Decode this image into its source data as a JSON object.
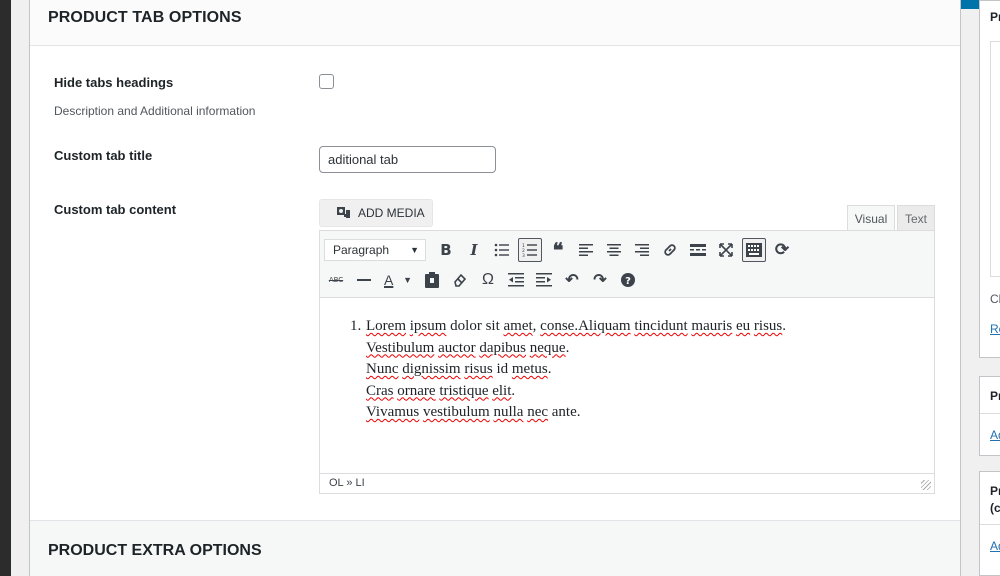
{
  "panel": {
    "title": "PRODUCT TAB OPTIONS",
    "hide_tabs": {
      "label": "Hide tabs headings",
      "description": "Description and Additional information",
      "checked": false
    },
    "custom_title": {
      "label": "Custom tab title",
      "value": "aditional tab"
    },
    "custom_content": {
      "label": "Custom tab content"
    }
  },
  "editor": {
    "add_media_label": "ADD MEDIA",
    "tabs": {
      "visual": "Visual",
      "text": "Text"
    },
    "format_select": "Paragraph",
    "list_number": "1.",
    "lines": [
      [
        {
          "t": "Lorem",
          "s": true
        },
        {
          "t": " "
        },
        {
          "t": "ipsum",
          "s": true
        },
        {
          "t": " dolor sit "
        },
        {
          "t": "amet",
          "s": true
        },
        {
          "t": ", "
        },
        {
          "t": "conse.Aliquam",
          "s": true
        },
        {
          "t": " "
        },
        {
          "t": "tincidunt",
          "s": true
        },
        {
          "t": " "
        },
        {
          "t": "mauris",
          "s": true
        },
        {
          "t": " "
        },
        {
          "t": "eu",
          "s": true
        },
        {
          "t": " "
        },
        {
          "t": "risus",
          "s": true
        },
        {
          "t": "."
        }
      ],
      [
        {
          "t": "Vestibulum",
          "s": true
        },
        {
          "t": " "
        },
        {
          "t": "auctor",
          "s": true
        },
        {
          "t": " "
        },
        {
          "t": "dapibus",
          "s": true
        },
        {
          "t": " "
        },
        {
          "t": "neque",
          "s": true
        },
        {
          "t": "."
        }
      ],
      [
        {
          "t": "Nunc",
          "s": true
        },
        {
          "t": " "
        },
        {
          "t": "dignissim",
          "s": true
        },
        {
          "t": " "
        },
        {
          "t": "risus",
          "s": true
        },
        {
          "t": " id "
        },
        {
          "t": "metus",
          "s": true
        },
        {
          "t": "."
        }
      ],
      [
        {
          "t": "Cras",
          "s": true
        },
        {
          "t": " "
        },
        {
          "t": "ornare",
          "s": true
        },
        {
          "t": " "
        },
        {
          "t": "tristique",
          "s": true
        },
        {
          "t": " "
        },
        {
          "t": "elit",
          "s": true
        },
        {
          "t": "."
        }
      ],
      [
        {
          "t": "Vivamus",
          "s": true
        },
        {
          "t": " "
        },
        {
          "t": "vestibulum",
          "s": true
        },
        {
          "t": " "
        },
        {
          "t": "nulla",
          "s": true
        },
        {
          "t": " "
        },
        {
          "t": "nec",
          "s": true
        },
        {
          "t": " ante."
        }
      ]
    ],
    "status_path": "OL » LI"
  },
  "section2": {
    "title": "PRODUCT EXTRA OPTIONS"
  },
  "sidebar": {
    "box1_title": "Pr",
    "box1_text": "Cl",
    "box1_link": "Re",
    "box2_title": "Pr",
    "box2_link": "Ad",
    "box3_title_line1": "Pr",
    "box3_title_line2": "(c",
    "box3_link": "Ad"
  },
  "colors": {
    "admin_bar": "#0073aa",
    "link": "#2271b1"
  }
}
